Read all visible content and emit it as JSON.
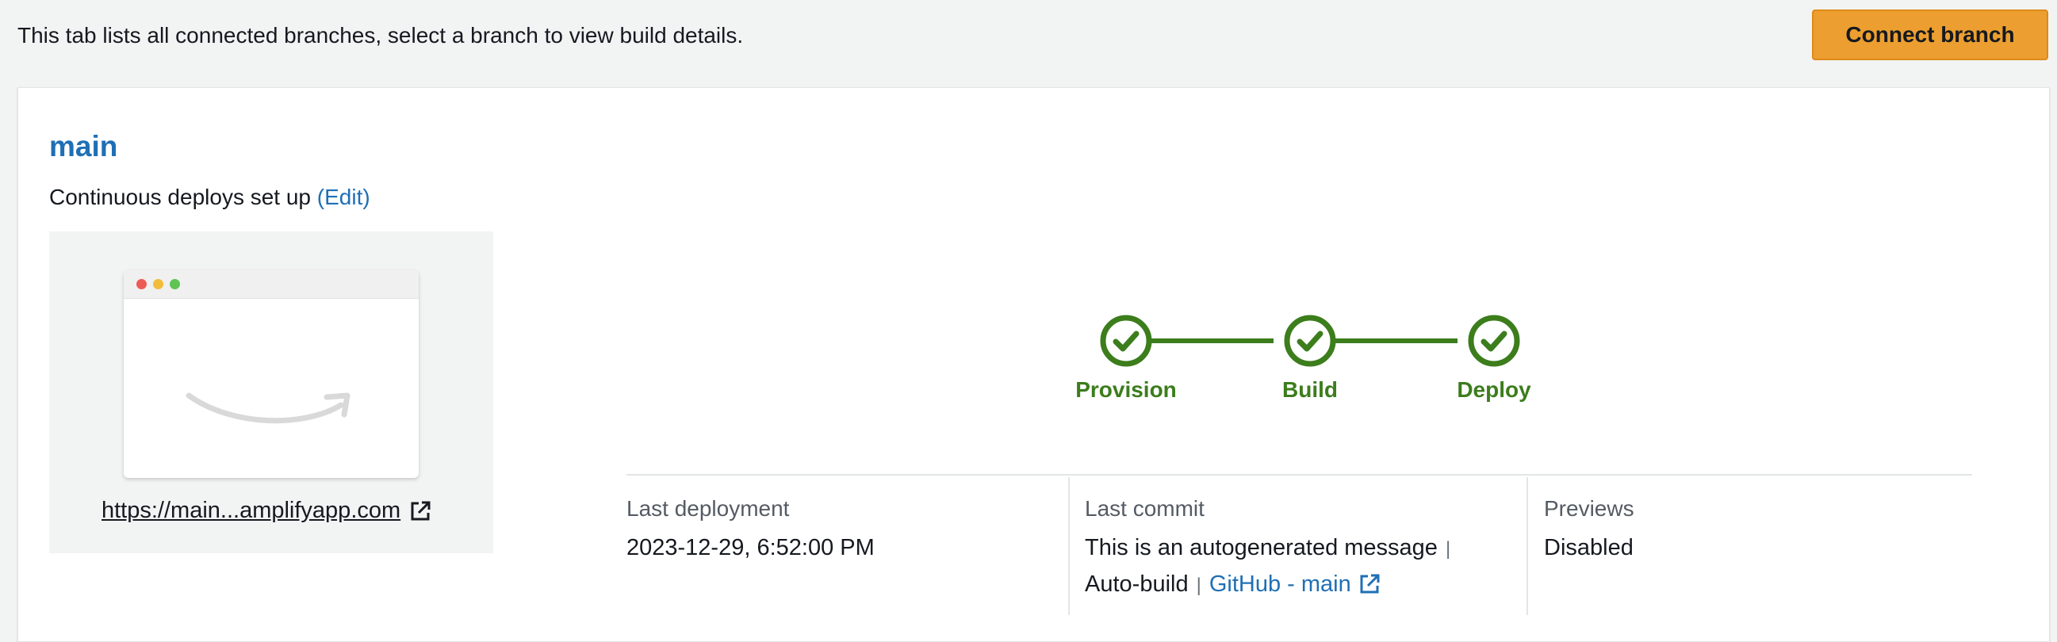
{
  "header": {
    "description": "This tab lists all connected branches, select a branch to view build details.",
    "connect_branch_label": "Connect branch"
  },
  "branch": {
    "name": "main",
    "deploy_status_text": "Continuous deploys set up",
    "edit_label": "(Edit)",
    "site_url": "https://main...amplifyapp.com"
  },
  "pipeline": {
    "steps": [
      {
        "label": "Provision",
        "status": "succeeded"
      },
      {
        "label": "Build",
        "status": "succeeded"
      },
      {
        "label": "Deploy",
        "status": "succeeded"
      }
    ]
  },
  "info": {
    "last_deployment": {
      "label": "Last deployment",
      "value": "2023-12-29, 6:52:00 PM"
    },
    "last_commit": {
      "label": "Last commit",
      "message": "This is an autogenerated message",
      "trigger": "Auto-build",
      "repo_link": "GitHub - main"
    },
    "previews": {
      "label": "Previews",
      "value": "Disabled"
    }
  },
  "colors": {
    "accent": "#ec9f30",
    "link": "#1f6fb5",
    "success": "#3c7d1c",
    "page_bg": "#f2f3f3"
  },
  "icons": [
    "external-link-icon",
    "check-circle-icon",
    "amazon-smile-logo",
    "browser-window-dots"
  ]
}
